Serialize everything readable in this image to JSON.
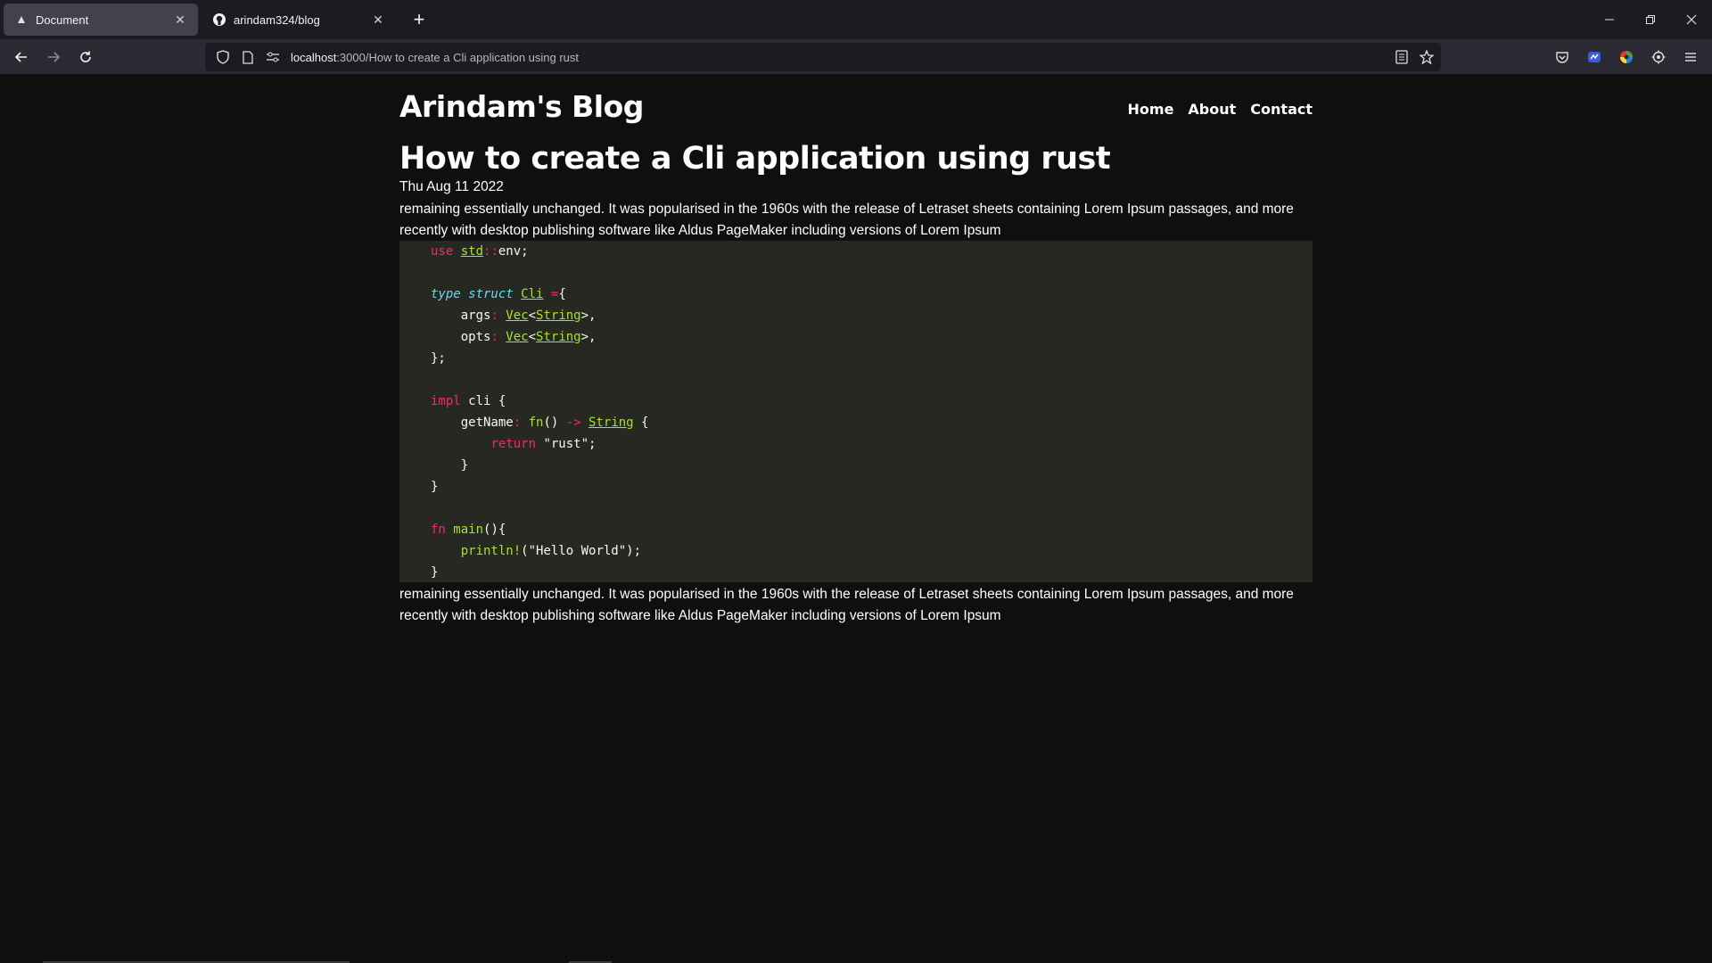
{
  "browser": {
    "tabs": [
      {
        "title": "Document",
        "active": true,
        "icon": "document-icon"
      },
      {
        "title": "arindam324/blog",
        "active": false,
        "icon": "github-icon"
      }
    ],
    "new_tab_symbol": "+",
    "close_symbol": "✕",
    "url_host": "localhost",
    "url_path": ":3000/How to create a Cli application using rust"
  },
  "site": {
    "blog_title": "Arindam's Blog",
    "nav": [
      "Home",
      "About",
      "Contact"
    ]
  },
  "post": {
    "title": "How to create a Cli application using rust",
    "date": "Thu Aug 11 2022",
    "paragraph_before": "remaining essentially unchanged. It was popularised in the 1960s with the release of Letraset sheets containing Lorem Ipsum passages, and more recently with desktop publishing software like Aldus PageMaker including versions of Lorem Ipsum",
    "paragraph_after": "remaining essentially unchanged. It was popularised in the 1960s with the release of Letraset sheets containing Lorem Ipsum passages, and more recently with desktop publishing software like Aldus PageMaker including versions of Lorem Ipsum",
    "code_lines": [
      [
        [
          "k",
          "use "
        ],
        [
          "t",
          "std"
        ],
        [
          "op",
          "::"
        ],
        [
          "plain",
          "env;"
        ]
      ],
      [],
      [
        [
          "kt",
          "type struct "
        ],
        [
          "t",
          "Cli"
        ],
        [
          "op",
          " ="
        ],
        [
          "plain",
          "{"
        ]
      ],
      [
        [
          "plain",
          "    args"
        ],
        [
          "op",
          ": "
        ],
        [
          "t",
          "Vec"
        ],
        [
          "plain",
          "<"
        ],
        [
          "t",
          "String"
        ],
        [
          "plain",
          ">,"
        ]
      ],
      [
        [
          "plain",
          "    opts"
        ],
        [
          "op",
          ": "
        ],
        [
          "t",
          "Vec"
        ],
        [
          "plain",
          "<"
        ],
        [
          "t",
          "String"
        ],
        [
          "plain",
          ">,"
        ]
      ],
      [
        [
          "plain",
          "};"
        ]
      ],
      [],
      [
        [
          "k",
          "impl "
        ],
        [
          "plain",
          "cli {"
        ]
      ],
      [
        [
          "plain",
          "    getName"
        ],
        [
          "op",
          ": "
        ],
        [
          "fn",
          "fn"
        ],
        [
          "plain",
          "() "
        ],
        [
          "op",
          "-> "
        ],
        [
          "t",
          "String"
        ],
        [
          "plain",
          " {"
        ]
      ],
      [
        [
          "plain",
          "        "
        ],
        [
          "k",
          "return "
        ],
        [
          "plain",
          "\"rust\";"
        ]
      ],
      [
        [
          "plain",
          "    }"
        ]
      ],
      [
        [
          "plain",
          "}"
        ]
      ],
      [],
      [
        [
          "k",
          "fn "
        ],
        [
          "fn",
          "main"
        ],
        [
          "plain",
          "(){"
        ]
      ],
      [
        [
          "plain",
          "    "
        ],
        [
          "fn",
          "println!"
        ],
        [
          "plain",
          "(\"Hello World\");"
        ]
      ],
      [
        [
          "plain",
          "}"
        ]
      ]
    ]
  },
  "colors": {
    "page_bg": "#0f0f10",
    "code_bg": "#272822",
    "keyword": "#f92672",
    "type": "#a6e22e",
    "storage": "#66d9ef"
  }
}
